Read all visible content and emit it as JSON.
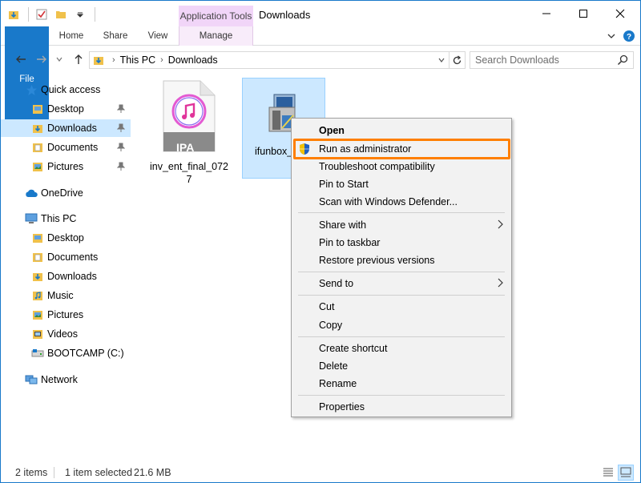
{
  "window": {
    "title": "Downloads",
    "context_group_title": "Application Tools"
  },
  "ribbon": {
    "tabs": [
      {
        "label": "File"
      },
      {
        "label": "Home"
      },
      {
        "label": "Share"
      },
      {
        "label": "View"
      },
      {
        "label": "Manage"
      }
    ]
  },
  "address": {
    "crumbs": [
      "This PC",
      "Downloads"
    ],
    "search_placeholder": "Search Downloads"
  },
  "nav": {
    "quick_access": "Quick access",
    "quick_items": [
      "Desktop",
      "Downloads",
      "Documents",
      "Pictures"
    ],
    "onedrive": "OneDrive",
    "this_pc": "This PC",
    "pc_items": [
      "Desktop",
      "Documents",
      "Downloads",
      "Music",
      "Pictures",
      "Videos",
      "BOOTCAMP (C:)"
    ],
    "network": "Network"
  },
  "files": [
    {
      "name": "inv_ent_final_0727",
      "badge": "IPA"
    },
    {
      "name": "ifunbox_"
    }
  ],
  "context_menu": {
    "open": "Open",
    "run_as_admin": "Run as administrator",
    "troubleshoot": "Troubleshoot compatibility",
    "pin_start": "Pin to Start",
    "scan": "Scan with Windows Defender...",
    "share_with": "Share with",
    "pin_taskbar": "Pin to taskbar",
    "restore": "Restore previous versions",
    "send_to": "Send to",
    "cut": "Cut",
    "copy": "Copy",
    "create_shortcut": "Create shortcut",
    "delete": "Delete",
    "rename": "Rename",
    "properties": "Properties"
  },
  "status": {
    "items": "2 items",
    "selected": "1 item selected",
    "size": "21.6 MB"
  },
  "colors": {
    "accent": "#1979ca",
    "selection": "#cce8ff",
    "highlight": "#ff7f00",
    "context_tab": "#f1d5f8"
  }
}
